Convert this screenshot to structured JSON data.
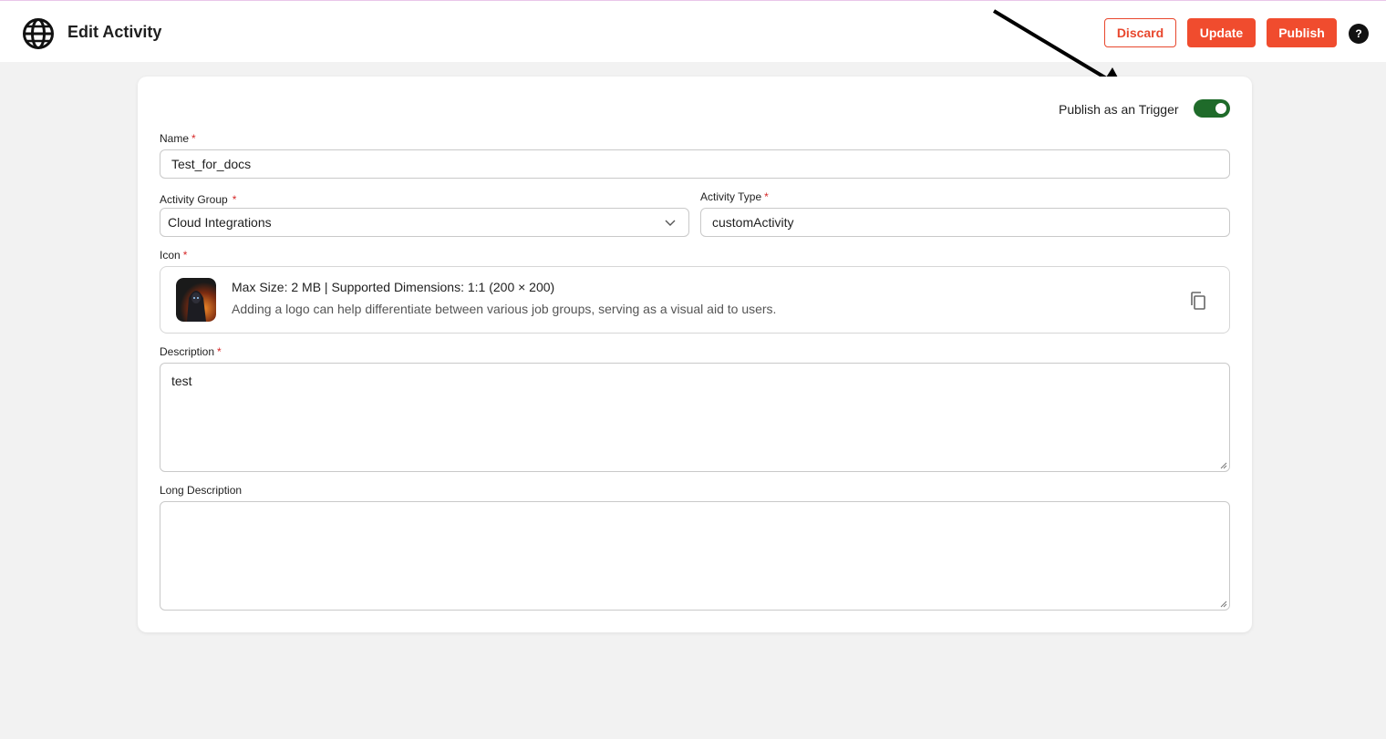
{
  "header": {
    "title": "Edit Activity",
    "discard_label": "Discard",
    "update_label": "Update",
    "publish_label": "Publish",
    "help_label": "?",
    "logo_icon": "globe-icon",
    "accent_color": "#f04c2e"
  },
  "form": {
    "trigger_toggle": {
      "label": "Publish as an Trigger",
      "on": true,
      "color": "#1f6b2a"
    },
    "name": {
      "label": "Name",
      "required": "*",
      "value": "Test_for_docs"
    },
    "activity_group": {
      "label": "Activity Group",
      "required": "*",
      "value": "Cloud Integrations"
    },
    "activity_type": {
      "label": "Activity Type",
      "required": "*",
      "value": "customActivity"
    },
    "icon": {
      "label": "Icon",
      "required": "*",
      "max_size_text": "Max Size: 2 MB | Supported Dimensions: 1:1 (200 × 200)",
      "help_text": "Adding a logo can help differentiate between various job groups, serving as a visual aid to users.",
      "action_icon": "copy-icon"
    },
    "description": {
      "label": "Description",
      "required": "*",
      "value": "test"
    },
    "long_description": {
      "label": "Long Description",
      "value": ""
    }
  }
}
